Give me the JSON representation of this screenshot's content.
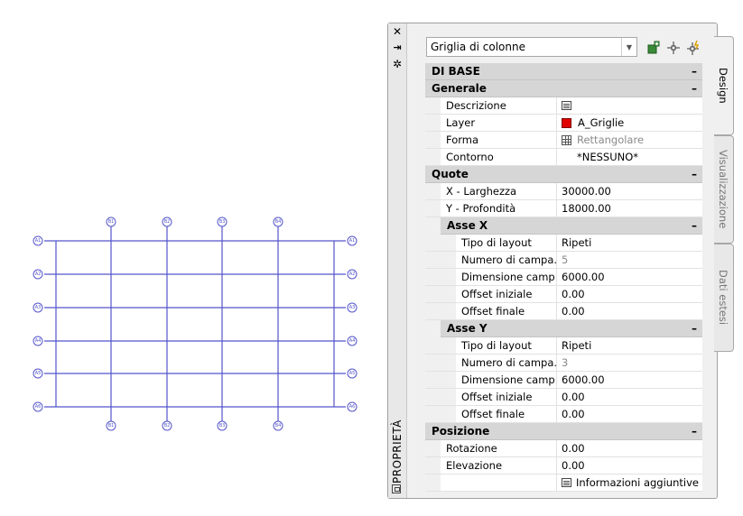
{
  "grid": {
    "top_labels": [
      "B1",
      "B2",
      "B3",
      "B4"
    ],
    "bottom_labels": [
      "B1",
      "B2",
      "B3",
      "B4"
    ],
    "left_labels": [
      "A1",
      "A2",
      "A3",
      "A4",
      "A5",
      "A6"
    ],
    "right_labels": [
      "A1",
      "A2",
      "A3",
      "A4",
      "A5",
      "A6"
    ],
    "line_color": "#5555cc"
  },
  "palette": {
    "title": "PROPRIETÀ",
    "close_glyph": "✕",
    "autohide_glyph": "⇥",
    "settings_glyph": "✲",
    "dropdown_value": "Griglia di colonne",
    "tabs": [
      "Design",
      "Visualizzazione",
      "Dati estesi"
    ],
    "collapse_glyph": "–"
  },
  "props": {
    "di_base": "DI BASE",
    "generale": {
      "label": "Generale",
      "descrizione": {
        "name": "Descrizione",
        "value": ""
      },
      "layer": {
        "name": "Layer",
        "value": "A_Griglie",
        "color": "#e00000"
      },
      "forma": {
        "name": "Forma",
        "value": "Rettangolare"
      },
      "contorno": {
        "name": "Contorno",
        "value": "*NESSUNO*"
      }
    },
    "quote": {
      "label": "Quote",
      "x_larghezza": {
        "name": "X - Larghezza",
        "value": "30000.00"
      },
      "y_profondita": {
        "name": "Y - Profondità",
        "value": "18000.00"
      },
      "asse_x": {
        "label": "Asse X",
        "tipo": {
          "name": "Tipo di layout",
          "value": "Ripeti"
        },
        "numero": {
          "name": "Numero di campa...",
          "value": "5"
        },
        "dimensione": {
          "name": "Dimensione  camp...",
          "value": "6000.00"
        },
        "offset_iniziale": {
          "name": "Offset iniziale",
          "value": "0.00"
        },
        "offset_finale": {
          "name": "Offset finale",
          "value": "0.00"
        }
      },
      "asse_y": {
        "label": "Asse Y",
        "tipo": {
          "name": "Tipo di layout",
          "value": "Ripeti"
        },
        "numero": {
          "name": "Numero di campa...",
          "value": "3"
        },
        "dimensione": {
          "name": "Dimensione  camp...",
          "value": "6000.00"
        },
        "offset_iniziale": {
          "name": "Offset iniziale",
          "value": "0.00"
        },
        "offset_finale": {
          "name": "Offset finale",
          "value": "0.00"
        }
      }
    },
    "posizione": {
      "label": "Posizione",
      "rotazione": {
        "name": "Rotazione",
        "value": "0.00"
      },
      "elevazione": {
        "name": "Elevazione",
        "value": "0.00"
      },
      "info": "Informazioni aggiuntive"
    }
  }
}
